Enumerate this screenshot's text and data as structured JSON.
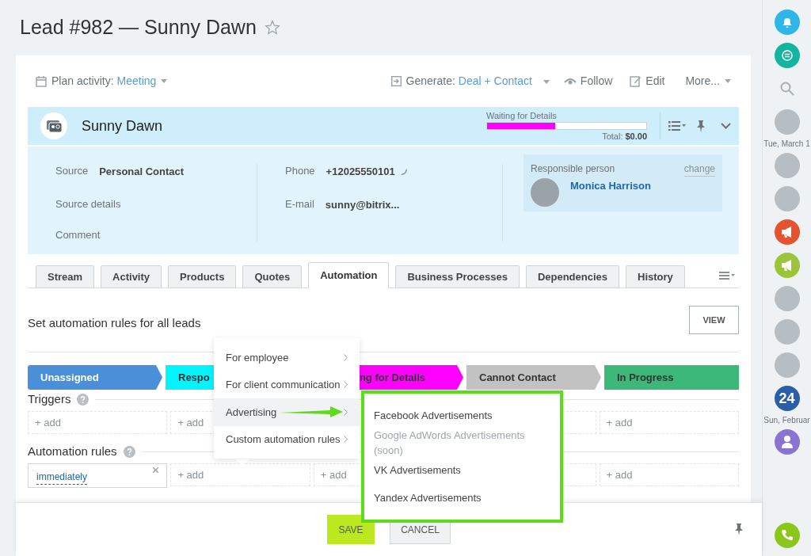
{
  "page_title": "Lead #982 — Sunny Dawn",
  "toolbar": {
    "plan_label": "Plan activity:",
    "plan_value": "Meeting",
    "generate_label": "Generate:",
    "generate_value": "Deal + Contact",
    "follow": "Follow",
    "edit": "Edit",
    "more": "More..."
  },
  "lead_header": {
    "name": "Sunny Dawn",
    "stage_label": "Waiting for Details",
    "level": 0.43,
    "total_label": "Total:",
    "total_value": "$0.00"
  },
  "details": {
    "left": [
      {
        "label": "Source",
        "value": "Personal Contact"
      },
      {
        "label": "Source details"
      },
      {
        "label": "Comment"
      }
    ],
    "middle": [
      {
        "label": "Phone",
        "value": "+12025550101",
        "kind": "phone"
      },
      {
        "label": "E-mail",
        "value": "sunny@bitrix...",
        "kind": "text"
      }
    ],
    "responsible": {
      "label": "Responsible person",
      "change": "change",
      "name": "Monica Harrison"
    }
  },
  "tabs": [
    {
      "label": "Stream",
      "selected": false
    },
    {
      "label": "Activity",
      "selected": false
    },
    {
      "label": "Products",
      "selected": false
    },
    {
      "label": "Quotes",
      "selected": false
    },
    {
      "label": "Automation",
      "selected": true
    },
    {
      "label": "Business Processes",
      "selected": false
    },
    {
      "label": "Dependencies",
      "selected": false
    },
    {
      "label": "History",
      "selected": false
    }
  ],
  "automation": {
    "title": "Set automation rules for all leads",
    "view_button": "VIEW",
    "stages": [
      {
        "label": "Unassigned",
        "color": "#4a90d9",
        "kind": "plain"
      },
      {
        "label": "Respo",
        "color": "#00f5ff",
        "kind": "plain"
      },
      {
        "label": "ng for Details",
        "color": "#ff00ff",
        "kind": "clipped"
      },
      {
        "label": "Cannot Contact",
        "color": "#c2c2c2",
        "kind": "plain"
      },
      {
        "label": "In Progress",
        "color": "#3cb878",
        "kind": "plain"
      }
    ],
    "triggers": {
      "title": "Triggers",
      "cells": [
        {
          "kind": "add",
          "text": "+ add"
        },
        {
          "kind": "add",
          "text": "+ add"
        },
        {
          "kind": "empty"
        },
        {
          "kind": "empty"
        },
        {
          "kind": "add",
          "text": "+ add"
        }
      ]
    },
    "rules": {
      "title": "Automation rules",
      "cells": [
        {
          "kind": "rule",
          "text": "immediately"
        },
        {
          "kind": "add",
          "text": "+ add"
        },
        {
          "kind": "add",
          "text": "+ add"
        },
        {
          "kind": "empty"
        },
        {
          "kind": "add",
          "text": "+ add"
        }
      ]
    }
  },
  "menu": {
    "items": [
      {
        "label": "For employee",
        "selected": false
      },
      {
        "label": "For client communication",
        "selected": false
      },
      {
        "label": "Advertising",
        "selected": true
      },
      {
        "label": "Custom automation rules",
        "selected": false
      }
    ]
  },
  "submenu": {
    "highlighted": true,
    "items": [
      {
        "label": "Facebook Advertisements",
        "disabled": false
      },
      {
        "label": "Google AdWords Advertisements (soon)",
        "disabled": true
      },
      {
        "label": "VK Advertisements",
        "disabled": false
      },
      {
        "label": "Yandex Advertisements",
        "disabled": false
      }
    ]
  },
  "footer": {
    "save": "SAVE",
    "cancel": "CANCEL"
  },
  "sidebar": [
    {
      "kind": "bell",
      "color": "#2fb6e8"
    },
    {
      "kind": "chat",
      "color": "#13b5a0"
    },
    {
      "kind": "search"
    },
    {
      "kind": "avatar"
    },
    {
      "kind": "date",
      "text": "Tue, March 1"
    },
    {
      "kind": "avatar"
    },
    {
      "kind": "avatar"
    },
    {
      "kind": "megaphone",
      "color": "#e5522d"
    },
    {
      "kind": "megaphone",
      "color": "#9cc43a"
    },
    {
      "kind": "avatar"
    },
    {
      "kind": "avatar"
    },
    {
      "kind": "avatar"
    },
    {
      "kind": "number",
      "text": "24",
      "color": "#2a5ea8"
    },
    {
      "kind": "date",
      "text": "Sun, Februar"
    },
    {
      "kind": "user",
      "color": "#8a73d1"
    },
    {
      "kind": "phone",
      "color": "#8bc71b"
    }
  ]
}
